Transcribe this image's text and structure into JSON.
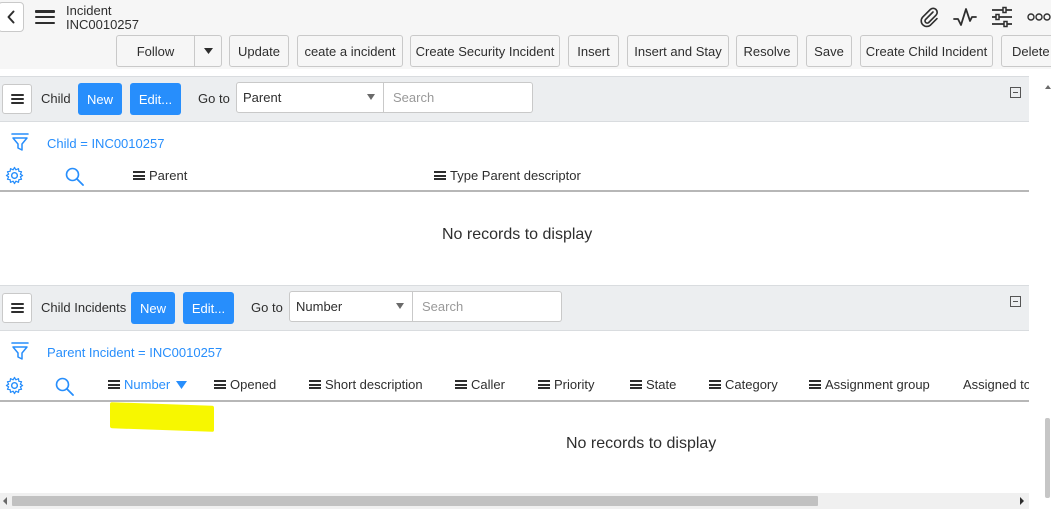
{
  "header": {
    "record_type": "Incident",
    "record_number": "INC0010257"
  },
  "toolbar": {
    "follow": "Follow",
    "update": "Update",
    "ceate_incident": "ceate a incident",
    "create_security_incident": "Create Security Incident",
    "insert": "Insert",
    "insert_and_stay": "Insert and Stay",
    "resolve": "Resolve",
    "save": "Save",
    "create_child_incident": "Create Child Incident",
    "delete": "Delete"
  },
  "related_lists": [
    {
      "title": "Child",
      "new_label": "New",
      "edit_label": "Edit...",
      "goto_label": "Go to",
      "goto_selected": "Parent",
      "search_placeholder": "Search",
      "breadcrumb": "Child = INC0010257",
      "columns": [
        "Parent",
        "Type Parent descriptor"
      ],
      "empty_message": "No records to display"
    },
    {
      "title": "Child Incidents",
      "new_label": "New",
      "edit_label": "Edit...",
      "goto_label": "Go to",
      "goto_selected": "Number",
      "search_placeholder": "Search",
      "breadcrumb": "Parent Incident = INC0010257",
      "columns": [
        "Number",
        "Opened",
        "Short description",
        "Caller",
        "Priority",
        "State",
        "Category",
        "Assignment group",
        "Assigned to"
      ],
      "sorted_column": "Number",
      "empty_message": "No records to display"
    }
  ],
  "icons": {
    "back": "chevron-left-icon",
    "menu": "hamburger-icon",
    "attachment": "paperclip-icon",
    "activity": "activity-pulse-icon",
    "settings": "sliders-icon",
    "more": "more-dots-icon",
    "filter": "funnel-icon",
    "personalize": "gear-icon",
    "search": "magnifier-icon"
  },
  "colors": {
    "accent": "#278efc",
    "highlight": "#f7f700"
  }
}
